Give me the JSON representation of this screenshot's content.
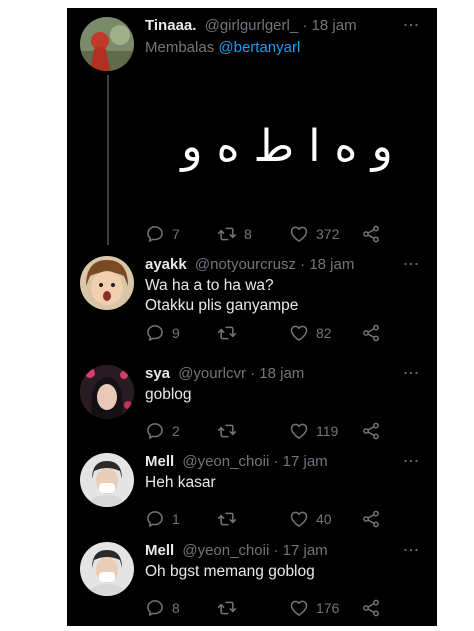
{
  "tweets": [
    {
      "name": "Tinaaa.",
      "handle": "@girlgurlgerl_",
      "time": "· 18 jam",
      "reply_prefix": "Membalas",
      "reply_to": "@bertanyarl",
      "text": "و ه ا ط ه و",
      "replies": "7",
      "retweets": "8",
      "likes": "372"
    },
    {
      "name": "ayakk",
      "handle": "@notyourcrusz",
      "time": "· 18 jam",
      "text_line1": "Wa ha a to ha wa?",
      "text_line2": "Otakku plis ganyampe",
      "replies": "9",
      "retweets": "",
      "likes": "82"
    },
    {
      "name": "sya",
      "handle": "@yourlcvr",
      "time": "· 18 jam",
      "text": "goblog",
      "replies": "2",
      "retweets": "",
      "likes": "119"
    },
    {
      "name": "Mell",
      "handle": "@yeon_choii",
      "time": "· 17 jam",
      "text": "Heh kasar",
      "replies": "1",
      "retweets": "",
      "likes": "40"
    },
    {
      "name": "Mell",
      "handle": "@yeon_choii",
      "time": "· 17 jam",
      "text": "Oh bgst memang goblog",
      "replies": "8",
      "retweets": "",
      "likes": "176"
    }
  ],
  "icons": {
    "reply": "reply-icon",
    "retweet": "retweet-icon",
    "like": "heart-icon",
    "share": "share-icon",
    "more": "more-vertical-icon"
  },
  "colors": {
    "background": "#000000",
    "primary_text": "#e7e9ea",
    "secondary_text": "#71767b",
    "mention": "#1d9bf0"
  }
}
